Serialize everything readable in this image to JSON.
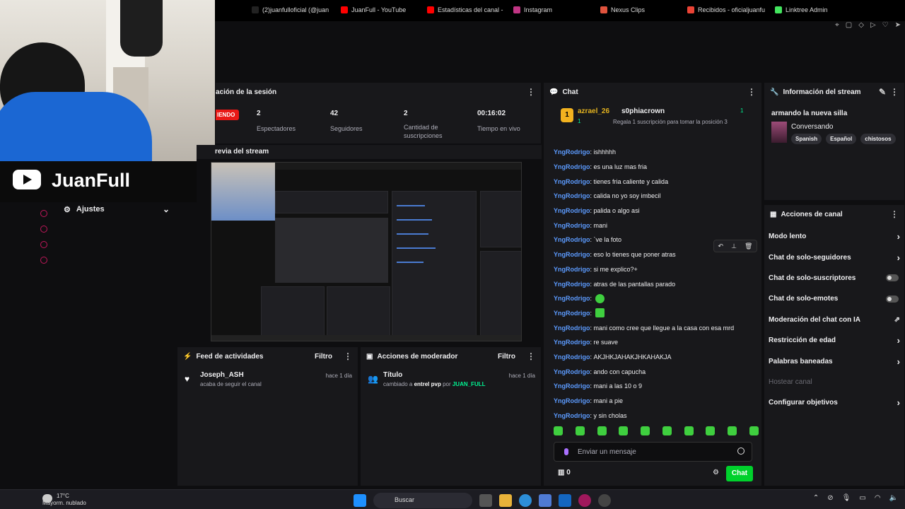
{
  "bookmarks": [
    {
      "label": "(2)juanfulloficial (@juan",
      "color": "#222"
    },
    {
      "label": "JuanFull - YouTube",
      "color": "#ff0000"
    },
    {
      "label": "Estadísticas del canal -",
      "color": "#ff0000"
    },
    {
      "label": "Instagram",
      "color": "#c13584"
    },
    {
      "label": "Nexus Clips",
      "color": "#e0533d"
    },
    {
      "label": "Recibidos - oficialjuanfu",
      "color": "#ea4335"
    },
    {
      "label": "Linktree Admin",
      "color": "#43e55e"
    }
  ],
  "overlay": {
    "channel_name": "JuanFull"
  },
  "left_nav": {
    "settings_label": "Ajustes"
  },
  "session": {
    "title": "ación de la sesión",
    "live_badge": "IENDO",
    "stats": [
      {
        "value": "2",
        "label": "Espectadores"
      },
      {
        "value": "42",
        "label": "Seguidores"
      },
      {
        "value": "2",
        "label": "Cantidad de suscripciones"
      },
      {
        "value": "00:16:02",
        "label": "Tiempo en vivo"
      }
    ]
  },
  "preview": {
    "title": "revia del stream"
  },
  "feed": {
    "title": "Feed de actividades",
    "filter": "Filtro",
    "items": [
      {
        "user": "Joseph_ASH",
        "desc": "acaba de seguir el canal",
        "time": "hace 1 día"
      }
    ]
  },
  "mod_actions": {
    "title": "Acciones de moderador",
    "filter": "Filtro",
    "item": {
      "title": "Título",
      "prefix": "cambiado a",
      "value": "entrel pvp",
      "by": "por",
      "user": "JUAN_FULL",
      "time": "hace 1 día"
    }
  },
  "chat": {
    "title": "Chat",
    "hype": {
      "rank": "1",
      "user1": "azrael_26",
      "count1": "1",
      "user2": "s0phiacrown",
      "count2": "1",
      "gift_text": "Regala 1 suscripción para tomar la posición 3"
    },
    "messages": [
      {
        "user": "YngRodrigo",
        "text": "ishhhhh"
      },
      {
        "user": "YngRodrigo",
        "text": "es una luz mas fria"
      },
      {
        "user": "YngRodrigo",
        "text": "tienes fria caliente y calida"
      },
      {
        "user": "YngRodrigo",
        "text": "calida no yo soy imbecil"
      },
      {
        "user": "YngRodrigo",
        "text": "palida o algo asi"
      },
      {
        "user": "YngRodrigo",
        "text": "mani"
      },
      {
        "user": "YngRodrigo",
        "text": "`ve la foto"
      },
      {
        "user": "YngRodrigo",
        "text": "eso lo tienes que poner atras"
      },
      {
        "user": "YngRodrigo",
        "text": "si me explico?+"
      },
      {
        "user": "YngRodrigo",
        "text": "atras de las pantallas parado"
      },
      {
        "user": "YngRodrigo",
        "text": "",
        "emote": "round"
      },
      {
        "user": "YngRodrigo",
        "text": "",
        "emote": "square"
      },
      {
        "user": "YngRodrigo",
        "text": "mani como cree que llegue a la casa con esa mrd"
      },
      {
        "user": "YngRodrigo",
        "text": "re suave"
      },
      {
        "user": "YngRodrigo",
        "text": "AKJHKJAHAKJHKAHAKJA"
      },
      {
        "user": "YngRodrigo",
        "text": "ando con capucha"
      },
      {
        "user": "YngRodrigo",
        "text": "mani a las 10 o 9"
      },
      {
        "user": "YngRodrigo",
        "text": "mani a pie"
      },
      {
        "user": "YngRodrigo",
        "text": "y sin cholas"
      }
    ],
    "input_placeholder": "Enviar un mensaje",
    "points": "0",
    "send_label": "Chat"
  },
  "stream_info": {
    "title": "Información del stream",
    "stream_title": "armando la nueva silla",
    "category": "Conversando",
    "tags": [
      "Spanish",
      "Español",
      "chistosos"
    ]
  },
  "channel_actions": {
    "title": "Acciones de canal",
    "items": [
      {
        "label": "Modo lento",
        "control": "chevron"
      },
      {
        "label": "Chat de solo-seguidores",
        "control": "chevron"
      },
      {
        "label": "Chat de solo-suscriptores",
        "control": "toggle"
      },
      {
        "label": "Chat de solo-emotes",
        "control": "toggle"
      },
      {
        "label": "Moderación del chat con IA",
        "control": "link"
      },
      {
        "label": "Restricción de edad",
        "control": "chevron"
      },
      {
        "label": "Palabras baneadas",
        "control": "chevron"
      },
      {
        "label": "Hostear canal",
        "control": "none",
        "disabled": true
      },
      {
        "label": "Configurar objetivos",
        "control": "chevron"
      }
    ]
  },
  "taskbar": {
    "temp": "17°C",
    "condition": "Mayorm. nublado",
    "search": "Buscar"
  }
}
